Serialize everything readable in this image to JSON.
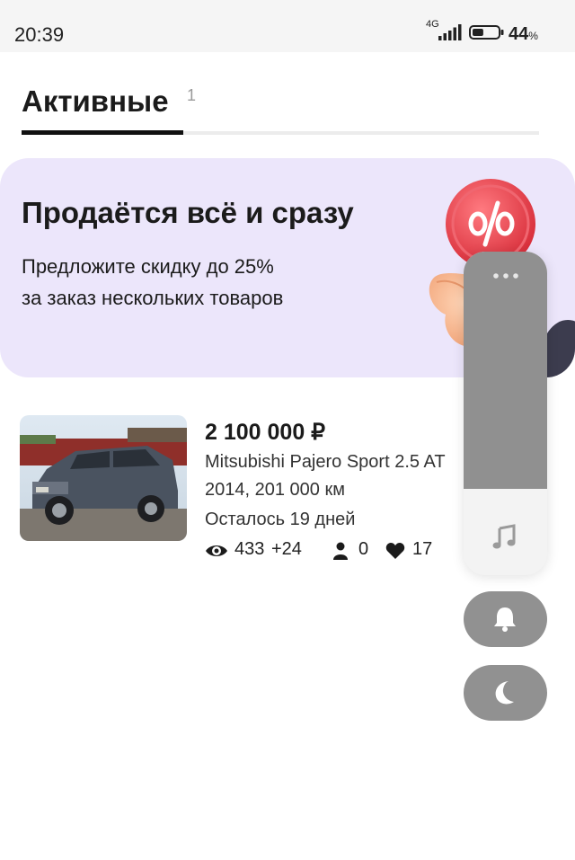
{
  "status_bar": {
    "time": "20:39",
    "network_type": "4G",
    "battery_percent": "44",
    "battery_unit": "%",
    "battery_level": 0.44
  },
  "tabs": [
    {
      "label": "Активные",
      "count": "1",
      "active": true
    }
  ],
  "promo": {
    "title": "Продаётся всё и сразу",
    "line1": "Предложите скидку до 25%",
    "line2": "за заказ нескольких товаров",
    "icon": "percent-icon",
    "accent_color": "#e8424c",
    "background_color": "#ece6fb"
  },
  "listing": {
    "price": "2 100 000 ₽",
    "model": "Mitsubishi Pajero Sport 2.5 AT",
    "specs": "2014, 201 000 км",
    "remaining": "Осталось 19 дней",
    "views": "433",
    "views_new": "+24",
    "contacts": "0",
    "favorites": "17",
    "icons": [
      "eye-icon",
      "person-icon",
      "heart-icon"
    ]
  },
  "overlay_panel": {
    "menu_icon": "more-dots-icon",
    "slider_icon": "music-note-icon",
    "buttons": [
      "bell-icon",
      "moon-icon"
    ],
    "fill_color": "#909090"
  }
}
